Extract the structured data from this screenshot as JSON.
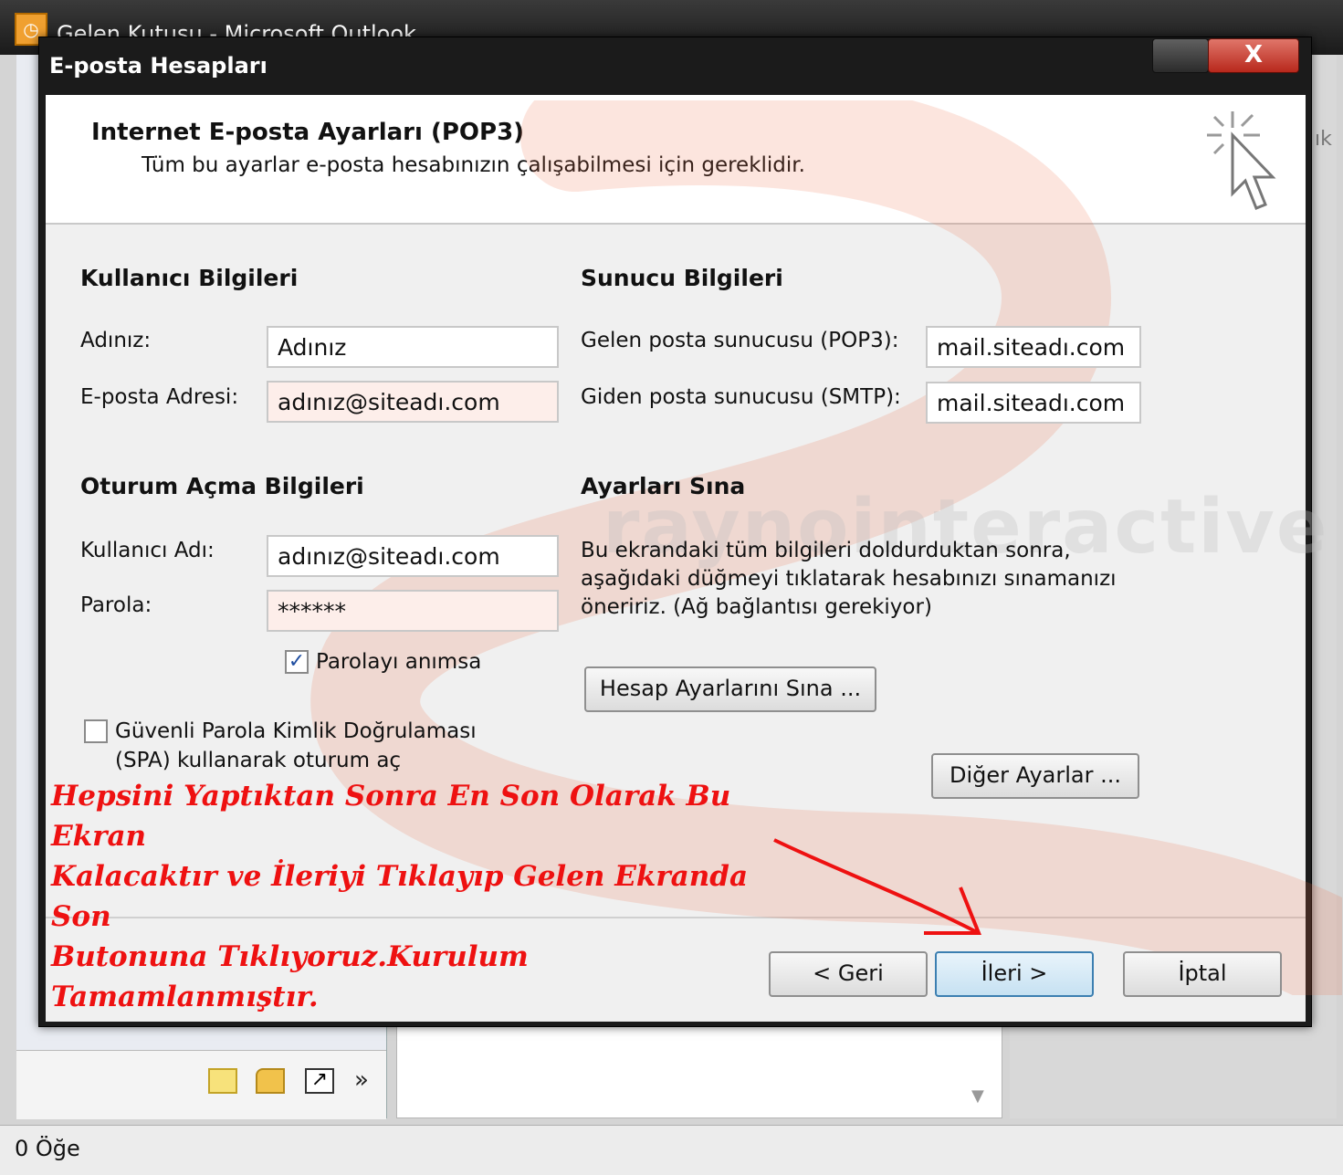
{
  "outlook": {
    "title": "Gelen Kutusu - Microsoft Outlook",
    "status": "0 Öğe",
    "right_pane_fragment": "ık"
  },
  "dialog": {
    "title": "E-posta Hesapları",
    "close_label": "X",
    "header_title": "Internet E-posta Ayarları (POP3)",
    "header_subtitle": "Tüm bu ayarlar e-posta hesabınızın çalışabilmesi için gereklidir."
  },
  "user_info": {
    "title": "Kullanıcı Bilgileri",
    "name_label": "Adınız:",
    "name_value": "Adınız",
    "email_label": "E-posta Adresi:",
    "email_value": "adınız@siteadı.com"
  },
  "server_info": {
    "title": "Sunucu Bilgileri",
    "incoming_label": "Gelen posta sunucusu (POP3):",
    "incoming_value": "mail.siteadı.com",
    "outgoing_label": "Giden posta sunucusu (SMTP):",
    "outgoing_value": "mail.siteadı.com"
  },
  "login_info": {
    "title": "Oturum Açma Bilgileri",
    "username_label": "Kullanıcı Adı:",
    "username_value": "adınız@siteadı.com",
    "password_label": "Parola:",
    "password_value": "******",
    "remember_label": "Parolayı anımsa",
    "remember_checked": true,
    "spa_label_line1": "Güvenli Parola Kimlik Doğrulaması",
    "spa_label_line2": "(SPA) kullanarak oturum aç",
    "spa_checked": false
  },
  "test_settings": {
    "title": "Ayarları Sına",
    "description": "Bu ekrandaki tüm bilgileri doldurduktan sonra, aşağıdaki düğmeyi tıklatarak hesabınızı sınamanızı öneririz. (Ağ bağlantısı gerekiyor)",
    "test_button": "Hesap Ayarlarını Sına ...",
    "more_button": "Diğer Ayarlar ..."
  },
  "footer": {
    "back_button": "< Geri",
    "next_button": "İleri >",
    "cancel_button": "İptal"
  },
  "annotation": {
    "line1": "Hepsini Yaptıktan Sonra En Son Olarak Bu Ekran",
    "line2": "Kalacaktır ve İleriyi Tıklayıp Gelen Ekranda Son",
    "line3": "Butonuna Tıklıyoruz.Kurulum Tamamlanmıştır.",
    "color": "#ee1111"
  },
  "watermark": "raynointeractive",
  "icons": [
    "outlook-app-icon",
    "cursor-sparkle-icon",
    "note-icon",
    "folder-icon",
    "shortcut-icon",
    "more-chevron-icon",
    "scroll-down-icon"
  ]
}
